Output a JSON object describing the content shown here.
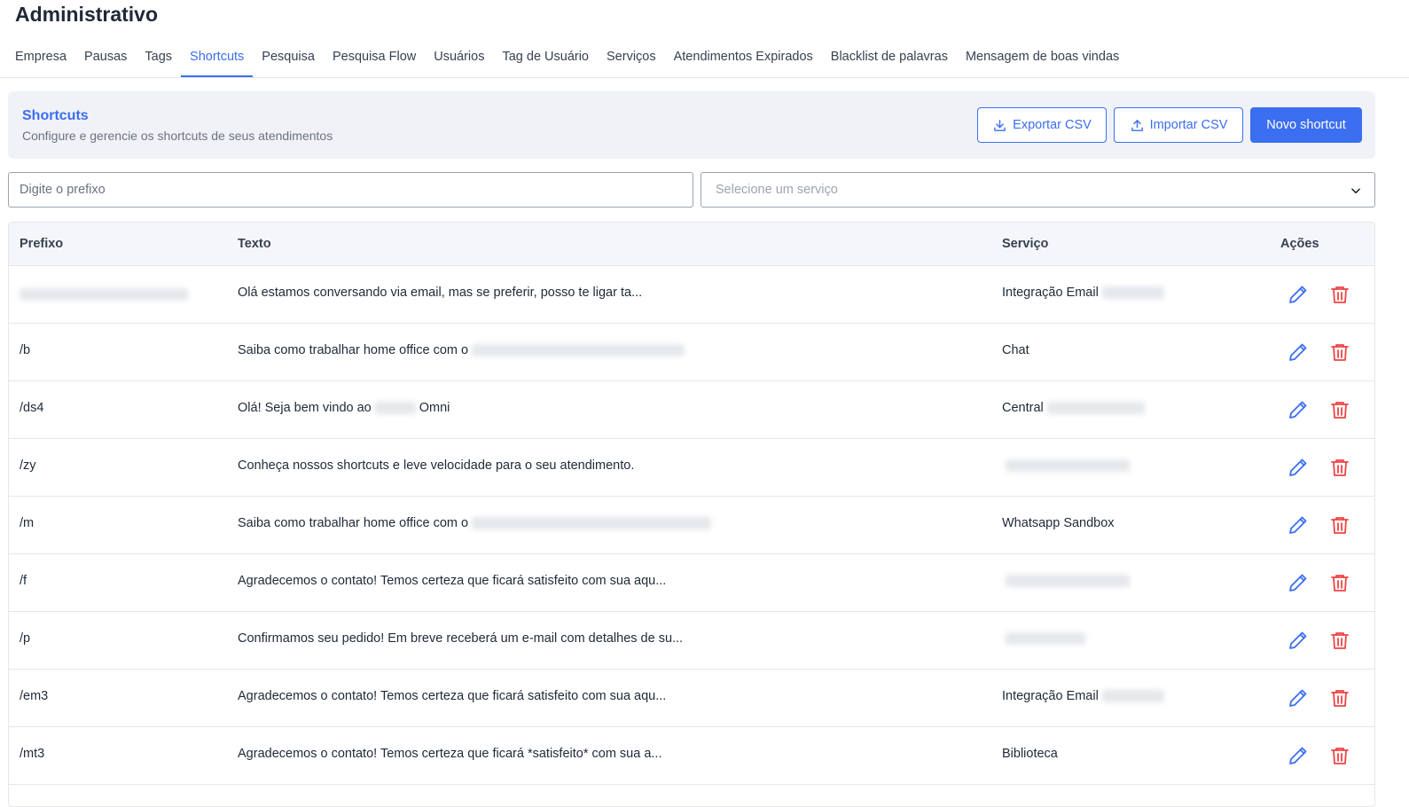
{
  "page": {
    "title": "Administrativo"
  },
  "tabs": [
    {
      "label": "Empresa",
      "active": false
    },
    {
      "label": "Pausas",
      "active": false
    },
    {
      "label": "Tags",
      "active": false
    },
    {
      "label": "Shortcuts",
      "active": true
    },
    {
      "label": "Pesquisa",
      "active": false
    },
    {
      "label": "Pesquisa Flow",
      "active": false
    },
    {
      "label": "Usuários",
      "active": false
    },
    {
      "label": "Tag de Usuário",
      "active": false
    },
    {
      "label": "Serviços",
      "active": false
    },
    {
      "label": "Atendimentos Expirados",
      "active": false
    },
    {
      "label": "Blacklist de palavras",
      "active": false
    },
    {
      "label": "Mensagem de boas vindas",
      "active": false
    }
  ],
  "header": {
    "title": "Shortcuts",
    "subtitle": "Configure e gerencie os shortcuts de seus atendimentos",
    "export_label": "Exportar CSV",
    "import_label": "Importar CSV",
    "new_label": "Novo shortcut"
  },
  "filters": {
    "prefix_placeholder": "Digite o prefixo",
    "service_placeholder": "Selecione um serviço"
  },
  "table": {
    "headers": {
      "prefix": "Prefixo",
      "text": "Texto",
      "service": "Serviço",
      "actions": "Ações"
    },
    "rows": [
      {
        "prefix": "",
        "text": "Olá estamos conversando via email, mas se preferir, posso te ligar ta...",
        "service": "Integração Email"
      },
      {
        "prefix": "/b",
        "text": "Saiba como trabalhar home office com o",
        "service": "Chat"
      },
      {
        "prefix": "/ds4",
        "text": "Olá! Seja bem vindo ao",
        "text_suffix": "Omni",
        "service": "Central"
      },
      {
        "prefix": "/zy",
        "text": "Conheça nossos shortcuts e leve velocidade para o seu atendimento.",
        "service": ""
      },
      {
        "prefix": "/m",
        "text": "Saiba como trabalhar home office com o",
        "service": "Whatsapp Sandbox"
      },
      {
        "prefix": "/f",
        "text": "Agradecemos o contato! Temos certeza que ficará satisfeito com sua aqu...",
        "service": ""
      },
      {
        "prefix": "/p",
        "text": "Confirmamos seu pedido! Em breve receberá um e-mail com detalhes de su...",
        "service": ""
      },
      {
        "prefix": "/em3",
        "text": "Agradecemos o contato! Temos certeza que ficará satisfeito com sua aqu...",
        "service": "Integração Email"
      },
      {
        "prefix": "/mt3",
        "text": "Agradecemos o contato! Temos certeza que ficará *satisfeito* com sua a...",
        "service": "Biblioteca"
      }
    ]
  },
  "icons": {
    "edit": "pencil-icon",
    "delete": "trash-icon",
    "download": "download-icon",
    "upload": "upload-icon",
    "chevron": "chevron-down-icon"
  },
  "colors": {
    "accent": "#3b6ef0",
    "danger": "#ef4444",
    "header_bg": "#f0f2f7"
  }
}
